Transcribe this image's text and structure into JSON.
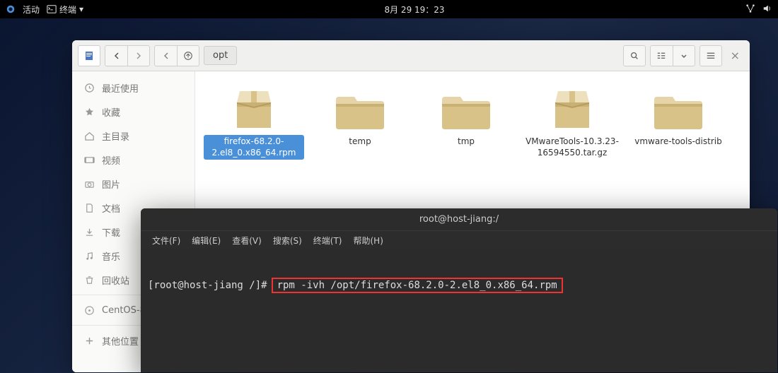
{
  "top_panel": {
    "activities": "活动",
    "app_name": "终端",
    "clock": "8月 29  19：23"
  },
  "file_manager": {
    "path_location": "opt",
    "sidebar": {
      "recent": "最近使用",
      "starred": "收藏",
      "home": "主目录",
      "videos": "视频",
      "pictures": "图片",
      "documents": "文档",
      "downloads": "下载",
      "music": "音乐",
      "trash": "回收站",
      "disk": "CentOS-8-…",
      "other": "其他位置"
    },
    "files": [
      {
        "name": "firefox-68.2.0-2.el8_0.x86_64.rpm",
        "type": "package",
        "selected": true
      },
      {
        "name": "temp",
        "type": "folder",
        "selected": false
      },
      {
        "name": "tmp",
        "type": "folder",
        "selected": false
      },
      {
        "name": "VMwareTools-10.3.23-16594550.tar.gz",
        "type": "package",
        "selected": false
      },
      {
        "name": "vmware-tools-distrib",
        "type": "folder",
        "selected": false
      }
    ]
  },
  "terminal": {
    "title": "root@host-jiang:/",
    "menu": {
      "file": "文件(F)",
      "edit": "编辑(E)",
      "view": "查看(V)",
      "search": "搜索(S)",
      "terminal": "终端(T)",
      "help": "帮助(H)"
    },
    "prompt": "[root@host-jiang /]#",
    "command": "rpm -ivh /opt/firefox-68.2.0-2.el8_0.x86_64.rpm"
  }
}
